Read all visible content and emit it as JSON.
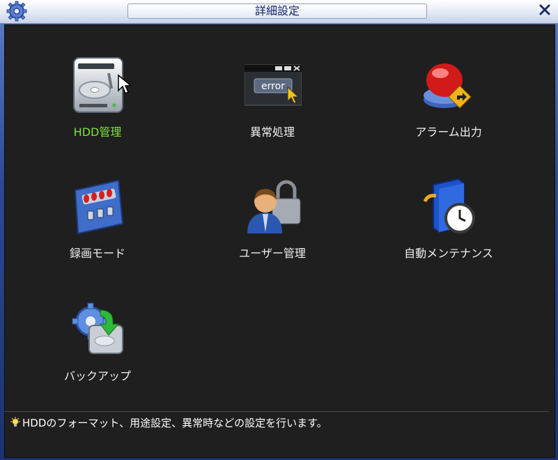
{
  "window": {
    "title": "詳細設定",
    "logo_icon": "gear-icon",
    "close_icon": "close-icon"
  },
  "menu": {
    "items": [
      {
        "label": "HDD管理",
        "icon": "hard-disk-icon",
        "selected": true
      },
      {
        "label": "異常処理",
        "icon": "error-window-icon",
        "selected": false
      },
      {
        "label": "アラーム出力",
        "icon": "alarm-button-icon",
        "selected": false
      },
      {
        "label": "録画モード",
        "icon": "record-panel-icon",
        "selected": false
      },
      {
        "label": "ユーザー管理",
        "icon": "user-lock-icon",
        "selected": false
      },
      {
        "label": "自動メンテナンス",
        "icon": "server-clock-icon",
        "selected": false
      },
      {
        "label": "バックアップ",
        "icon": "backup-disk-icon",
        "selected": false
      }
    ]
  },
  "status": {
    "hint": "HDDのフォーマット、用途設定、異常時などの設定を行います。",
    "hint_icon": "lightbulb-icon"
  },
  "colors": {
    "selected_label": "#7ee03c",
    "panel_background": "#1f1f1f",
    "title_text": "#10226a"
  }
}
